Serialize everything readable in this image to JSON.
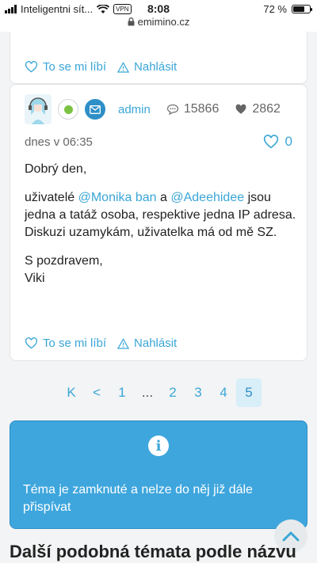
{
  "statusbar": {
    "carrier": "Inteligentni sít...",
    "vpn": "VPN",
    "time": "8:08",
    "battery": "72 %"
  },
  "url": "emimino.cz",
  "prev_post": {
    "like_label": "To se mi líbí",
    "report_label": "Nahlásit"
  },
  "post": {
    "author": "admin",
    "posts_count": "15866",
    "hearts_count": "2862",
    "date": "dnes v 06:35",
    "likes": "0",
    "greeting": "Dobrý den,",
    "p2_pre": "uživatelé ",
    "mention1": "@Monika ban",
    "p2_mid": " a ",
    "mention2": "@Adeehidee",
    "p2_post": " jsou jedna a tatáž osoba, respektive jedna IP adresa. Diskuzi uzamykám, uživatelka má od mě SZ.",
    "signoff": "S pozdravem,",
    "signature": "Viki",
    "like_label": "To se mi líbí",
    "report_label": "Nahlásit"
  },
  "pagination": {
    "first": "K",
    "prev": "<",
    "pages": [
      "1",
      "...",
      "2",
      "3",
      "4",
      "5"
    ],
    "current": "5"
  },
  "notice": {
    "text": "Téma je zamknuté a nelze do něj již dále přispívat"
  },
  "section_heading": "Další podobná témata podle názvu",
  "colors": {
    "accent": "#3aa6d6",
    "notice_bg": "#3ea6dd",
    "online": "#7cc242"
  }
}
